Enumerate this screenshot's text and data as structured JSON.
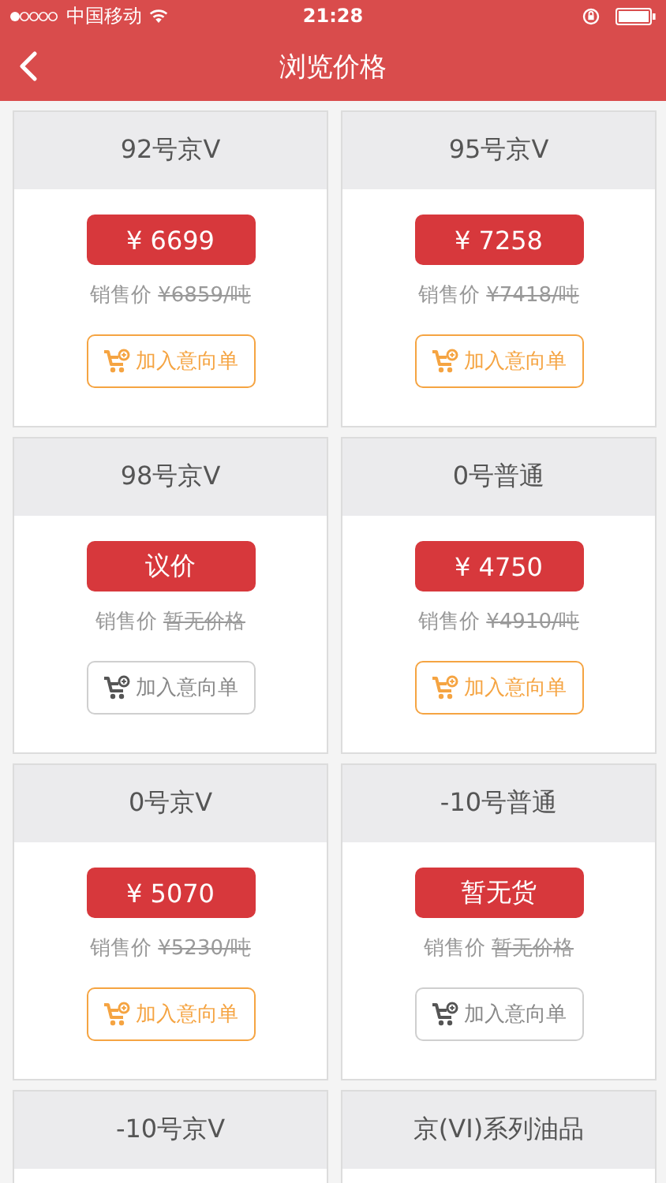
{
  "status_bar": {
    "carrier": "中国移动",
    "time": "21:28"
  },
  "nav": {
    "title": "浏览价格"
  },
  "products": [
    {
      "name": "92号京V",
      "price": "¥ 6699",
      "sale_label": "销售价",
      "sale_price": "¥6859/吨",
      "add_label": "加入意向单",
      "disabled": false
    },
    {
      "name": "95号京V",
      "price": "¥ 7258",
      "sale_label": "销售价",
      "sale_price": "¥7418/吨",
      "add_label": "加入意向单",
      "disabled": false
    },
    {
      "name": "98号京V",
      "price": "议价",
      "sale_label": "销售价",
      "sale_price": "暂无价格",
      "add_label": "加入意向单",
      "disabled": true
    },
    {
      "name": "0号普通",
      "price": "¥ 4750",
      "sale_label": "销售价",
      "sale_price": "¥4910/吨",
      "add_label": "加入意向单",
      "disabled": false
    },
    {
      "name": "0号京V",
      "price": "¥ 5070",
      "sale_label": "销售价",
      "sale_price": "¥5230/吨",
      "add_label": "加入意向单",
      "disabled": false
    },
    {
      "name": "-10号普通",
      "price": "暂无货",
      "sale_label": "销售价",
      "sale_price": "暂无价格",
      "add_label": "加入意向单",
      "disabled": true
    },
    {
      "name": "-10号京V"
    },
    {
      "name": "京(VI)系列油品"
    }
  ]
}
